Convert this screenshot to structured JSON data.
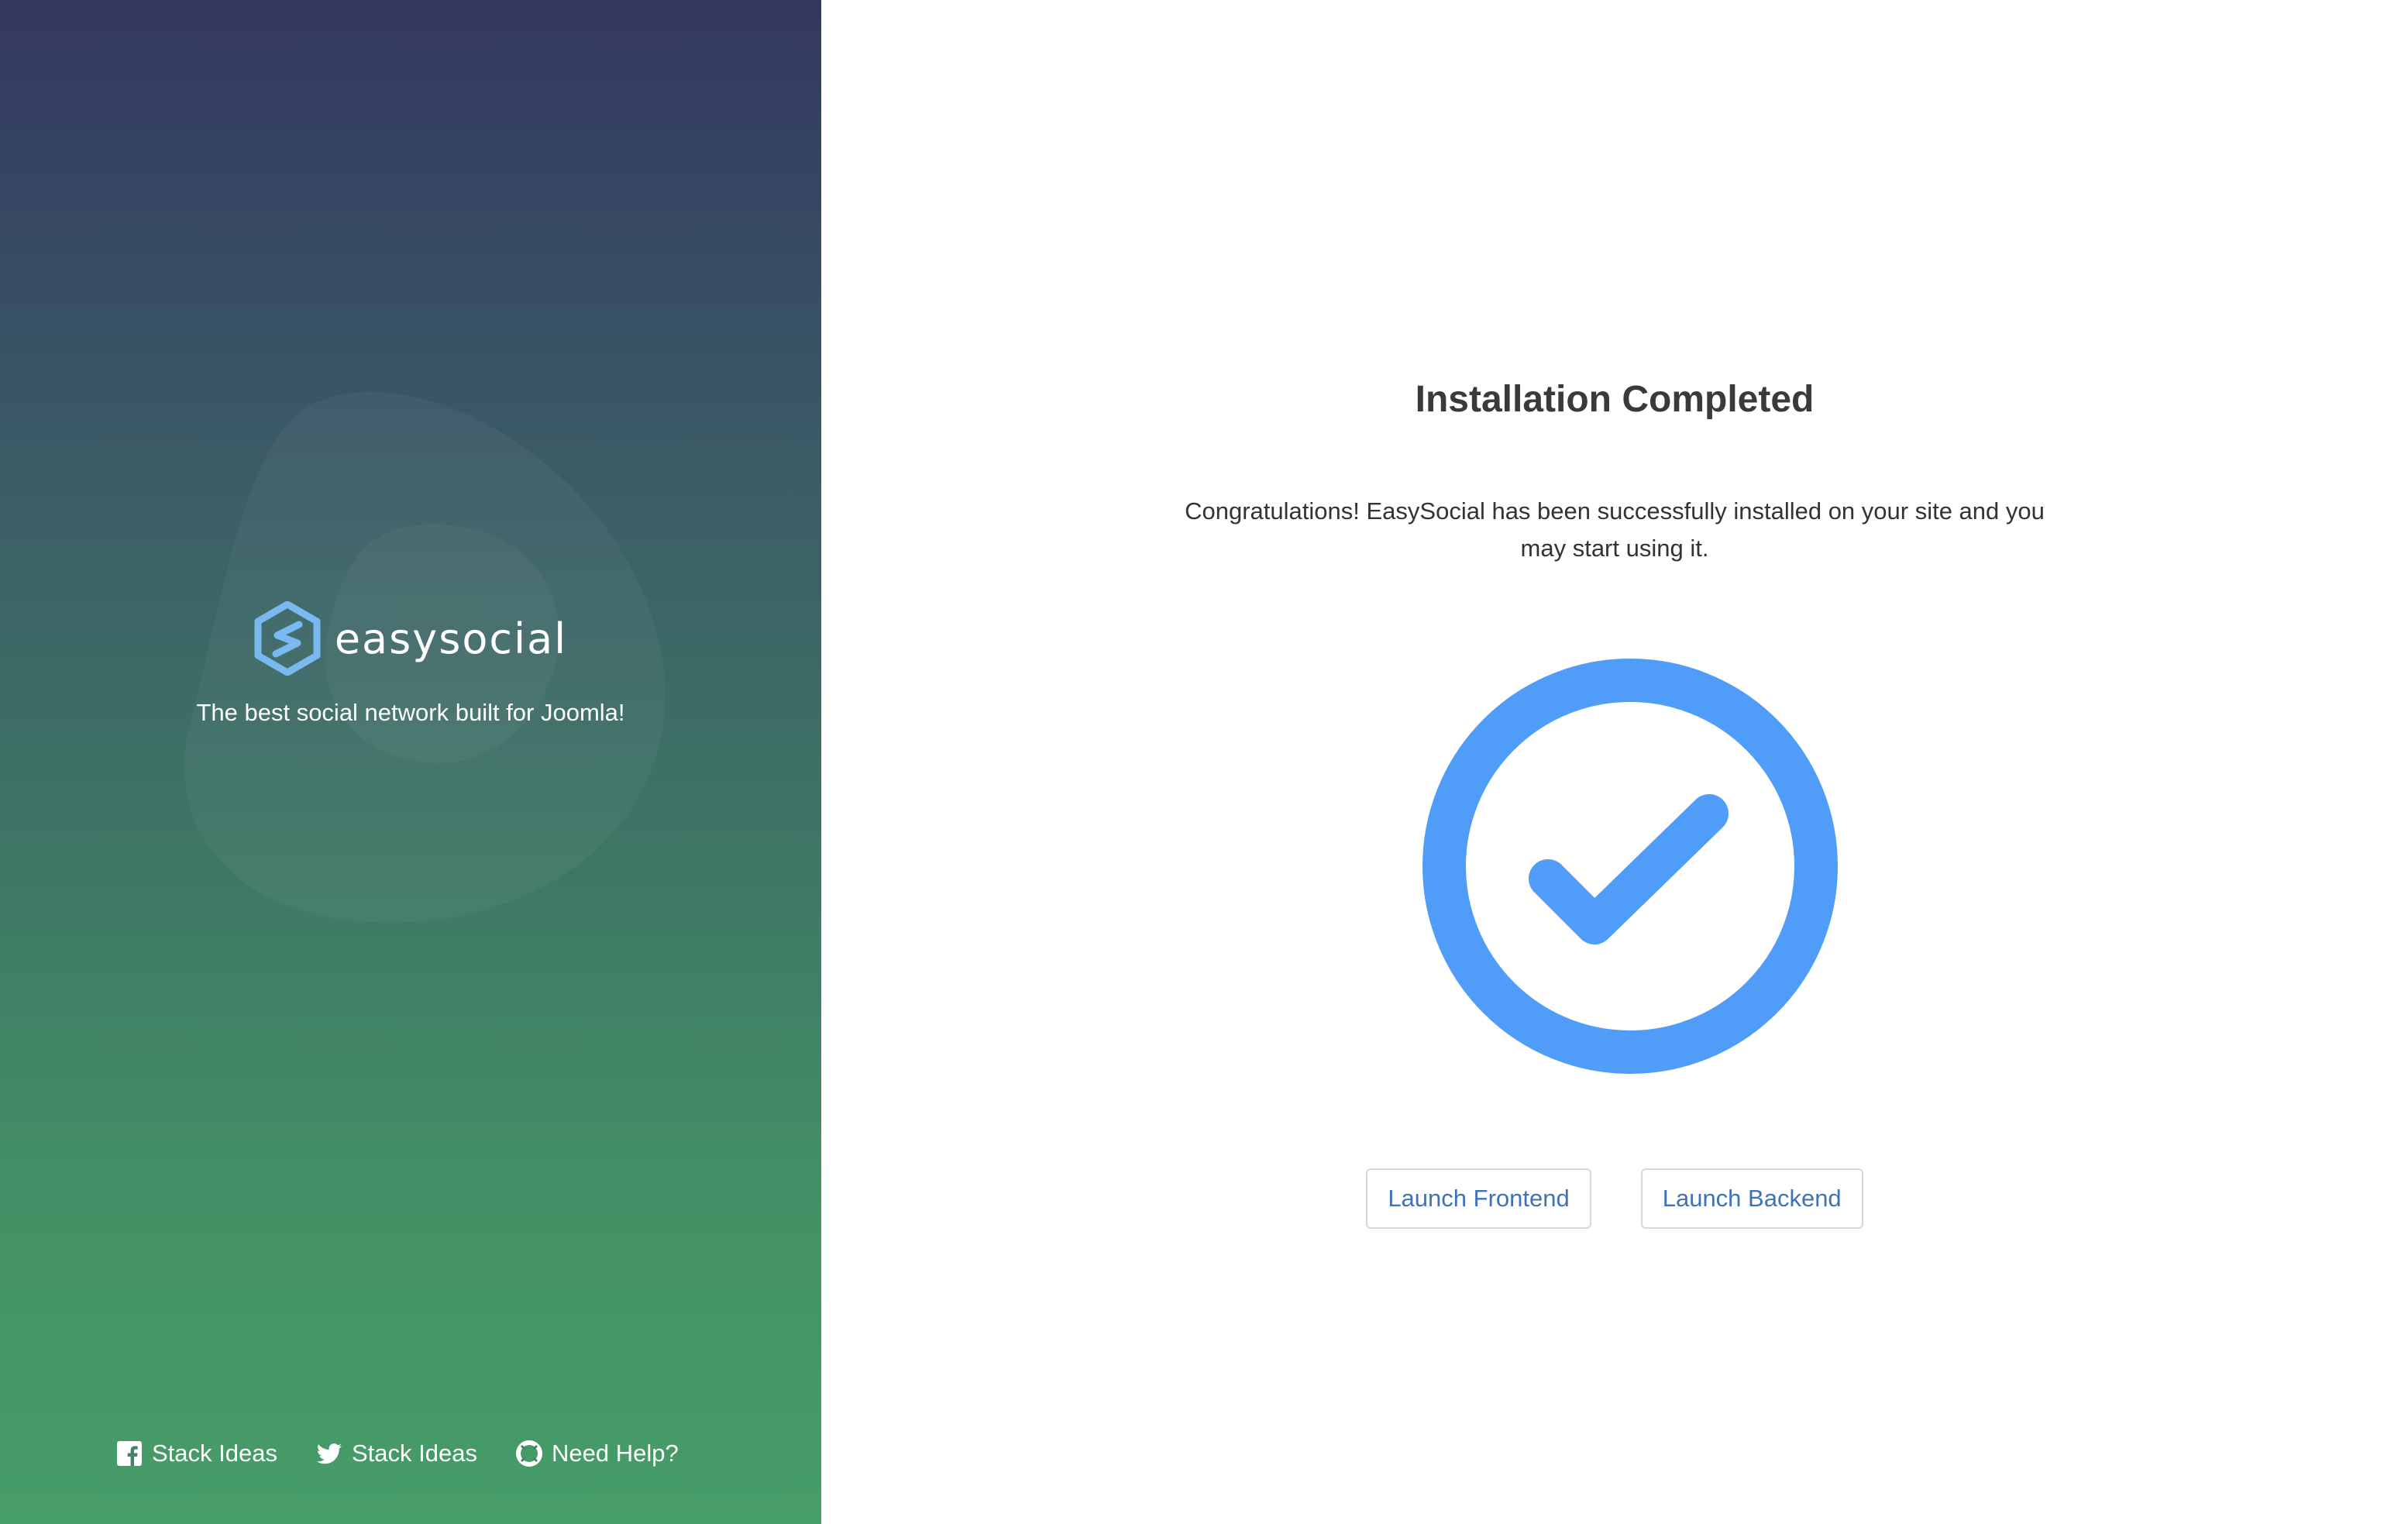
{
  "sidebar": {
    "logo_text": "easysocial",
    "tagline": "The best social network built for Joomla!",
    "footer_links": [
      {
        "icon": "facebook-icon",
        "label": "Stack Ideas"
      },
      {
        "icon": "twitter-icon",
        "label": "Stack Ideas"
      },
      {
        "icon": "lifebuoy-icon",
        "label": "Need Help?"
      }
    ]
  },
  "main": {
    "title": "Installation Completed",
    "message": "Congratulations! EasySocial has been successfully installed on your site and you may start using it.",
    "status_icon": "check-circle-icon",
    "buttons": {
      "frontend": "Launch Frontend",
      "backend": "Launch Backend"
    }
  },
  "colors": {
    "accent": "#4f9cf9",
    "link": "#3f72b8",
    "gradient_top": "#333760",
    "gradient_bottom": "#479d68"
  }
}
